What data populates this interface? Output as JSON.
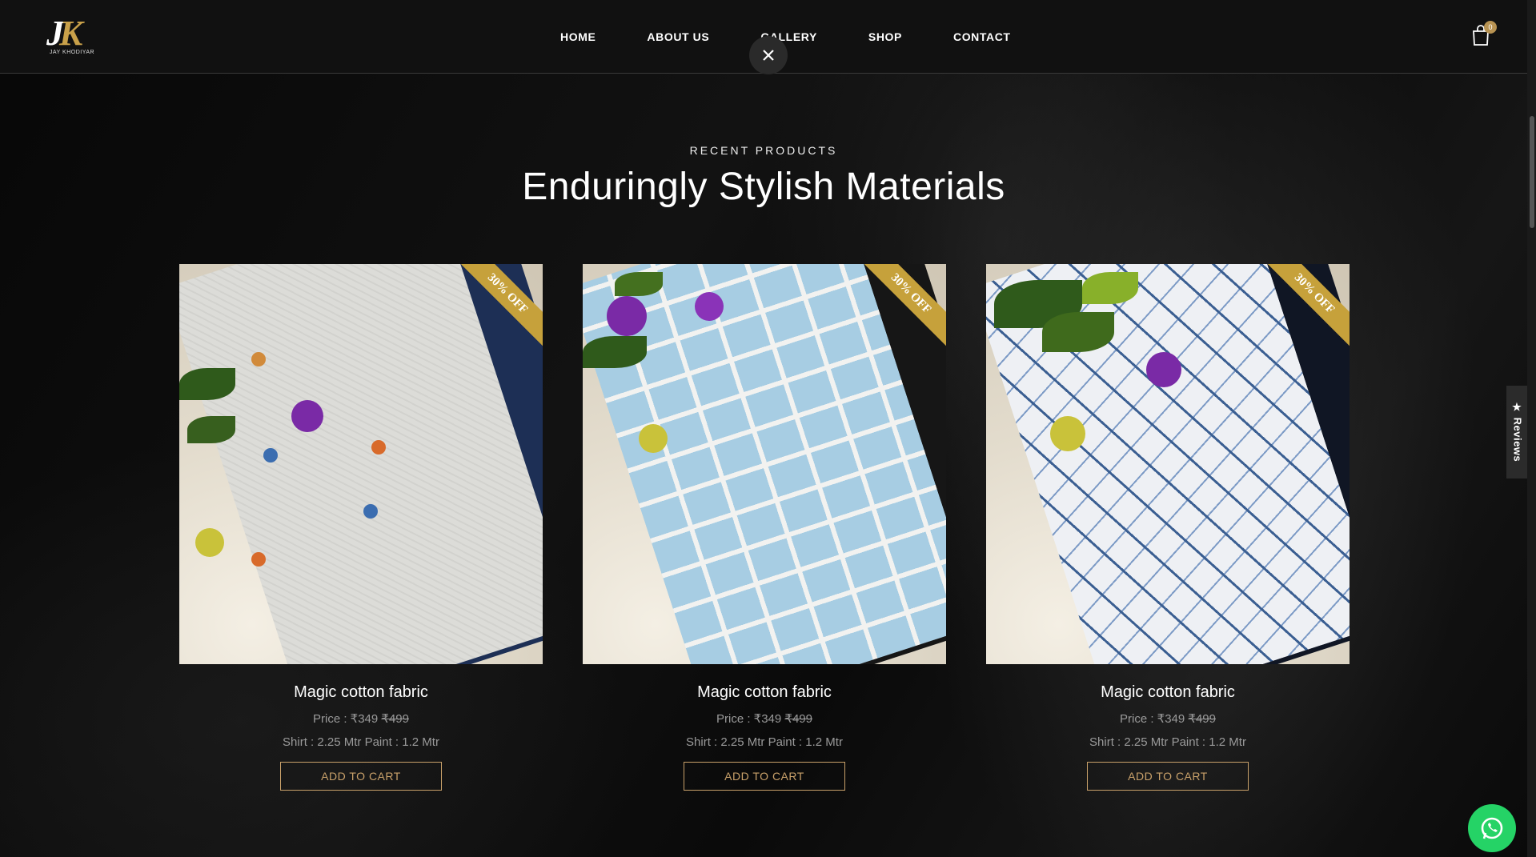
{
  "brand": {
    "monogram_j": "J",
    "monogram_k": "K",
    "name": "JAY KHODIYAR"
  },
  "nav": {
    "items": [
      "HOME",
      "ABOUT US",
      "GALLERY",
      "SHOP",
      "CONTACT"
    ]
  },
  "cart": {
    "count": "0"
  },
  "section": {
    "eyebrow": "RECENT PRODUCTS",
    "title": "Enduringly Stylish Materials"
  },
  "products": [
    {
      "title": "Magic cotton fabric",
      "price_label": "Price : ",
      "price": "₹349",
      "old_price": "₹499",
      "measure": "Shirt : 2.25 Mtr  Paint : 1.2 Mtr",
      "badge": "30% OFF",
      "cta": "ADD TO CART",
      "fabric_color": "#dcdcd8",
      "pattern_color": "#b9a84a",
      "base_cloth": "#1d2f55"
    },
    {
      "title": "Magic cotton fabric",
      "price_label": "Price : ",
      "price": "₹349",
      "old_price": "₹499",
      "measure": "Shirt : 2.25 Mtr  Paint : 1.2 Mtr",
      "badge": "30% OFF",
      "cta": "ADD TO CART",
      "fabric_color": "#a7cde3",
      "pattern_color": "#f2f2f0",
      "base_cloth": "#161616"
    },
    {
      "title": "Magic cotton fabric",
      "price_label": "Price : ",
      "price": "₹349",
      "old_price": "₹499",
      "measure": "Shirt : 2.25 Mtr  Paint : 1.2 Mtr",
      "badge": "30% OFF",
      "cta": "ADD TO CART",
      "fabric_color": "#eef0f4",
      "pattern_color": "#3b5f92",
      "base_cloth": "#101624"
    }
  ],
  "reviews": {
    "label": "★ Reviews"
  },
  "colors": {
    "accent": "#c9a16a",
    "badge": "#c6a13b",
    "whatsapp": "#25d366"
  }
}
